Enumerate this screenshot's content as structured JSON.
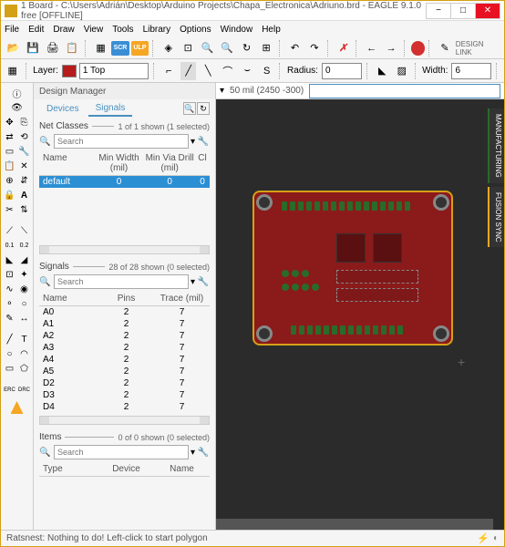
{
  "titlebar": {
    "title": "1 Board - C:\\Users\\Adrián\\Desktop\\Arduino Projects\\Chapa_Electronica\\Adriuno.brd - EAGLE 9.1.0 free [OFFLINE]"
  },
  "menubar": [
    "File",
    "Edit",
    "Draw",
    "View",
    "Tools",
    "Library",
    "Options",
    "Window",
    "Help"
  ],
  "toolbar2": {
    "layer_label": "Layer:",
    "layer_value": "1 Top",
    "radius_label": "Radius:",
    "radius_value": "0",
    "width_label": "Width:",
    "width_value": "6"
  },
  "design_link": "DESIGN LINK",
  "design_manager": {
    "title": "Design Manager",
    "tabs": {
      "devices": "Devices",
      "signals": "Signals"
    },
    "netclasses": {
      "title": "Net Classes",
      "count": "1 of 1 shown (1 selected)",
      "search_placeholder": "Search",
      "headers": [
        "Name",
        "Min Width (mil)",
        "Min Via Drill (mil)",
        "Cl"
      ],
      "rows": [
        {
          "name": "default",
          "minw": "0",
          "mind": "0",
          "cl": "0"
        }
      ]
    },
    "signals": {
      "title": "Signals",
      "count": "28 of 28 shown (0 selected)",
      "search_placeholder": "Search",
      "headers": [
        "Name",
        "Pins",
        "Trace (mil)"
      ],
      "rows": [
        {
          "name": "A0",
          "pins": "2",
          "trace": "7"
        },
        {
          "name": "A1",
          "pins": "2",
          "trace": "7"
        },
        {
          "name": "A2",
          "pins": "2",
          "trace": "7"
        },
        {
          "name": "A3",
          "pins": "2",
          "trace": "7"
        },
        {
          "name": "A4",
          "pins": "2",
          "trace": "7"
        },
        {
          "name": "A5",
          "pins": "2",
          "trace": "7"
        },
        {
          "name": "D2",
          "pins": "2",
          "trace": "7"
        },
        {
          "name": "D3",
          "pins": "2",
          "trace": "7"
        },
        {
          "name": "D4",
          "pins": "2",
          "trace": "7"
        }
      ]
    },
    "items": {
      "title": "Items",
      "count": "0 of 0 shown (0 selected)",
      "search_placeholder": "Search",
      "headers": [
        "Type",
        "Device",
        "Name"
      ]
    }
  },
  "canvas": {
    "grid_info": "50 mil (2450 -300)",
    "cmd": "",
    "side_tabs": {
      "manufacturing": "MANUFACTURING",
      "fusion": "FUSION SYNC"
    }
  },
  "statusbar": {
    "msg": "Ratsnest: Nothing to do! Left-click to start polygon"
  },
  "scr_label": "SCR",
  "ulp_label": "ULP",
  "erc_label": "ERC",
  "drc_label": "DRC"
}
